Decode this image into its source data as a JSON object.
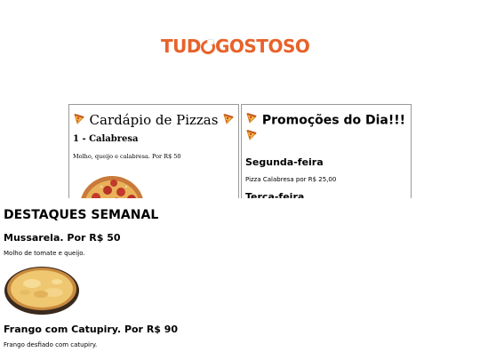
{
  "brand": {
    "logo_text_left": "TUD",
    "logo_text_right": "GOSTOSO",
    "color": "#e8622a"
  },
  "menu_panel": {
    "title": "Cardápio de Pizzas",
    "item_title": "1 - Calabresa",
    "item_desc": "Molho, queijo e calabresa. Por R$ 50",
    "pizza_icon": "pizza-slice-icon"
  },
  "promo_panel": {
    "title": "Promoções do Dia!!!",
    "day1": "Segunda-feira",
    "day1_desc": "Pizza Calabresa por R$ 25,00",
    "day2": "Terça-feira",
    "pizza_icon": "pizza-slice-icon"
  },
  "featured": {
    "heading": "DESTAQUES SEMANAL",
    "items": [
      {
        "name": "Mussarela. Por R$ 50",
        "desc": "Molho de tomate e queijo."
      },
      {
        "name": "Frango com Catupiry. Por R$ 90",
        "desc": "Frango desfiado com catupiry."
      }
    ]
  }
}
